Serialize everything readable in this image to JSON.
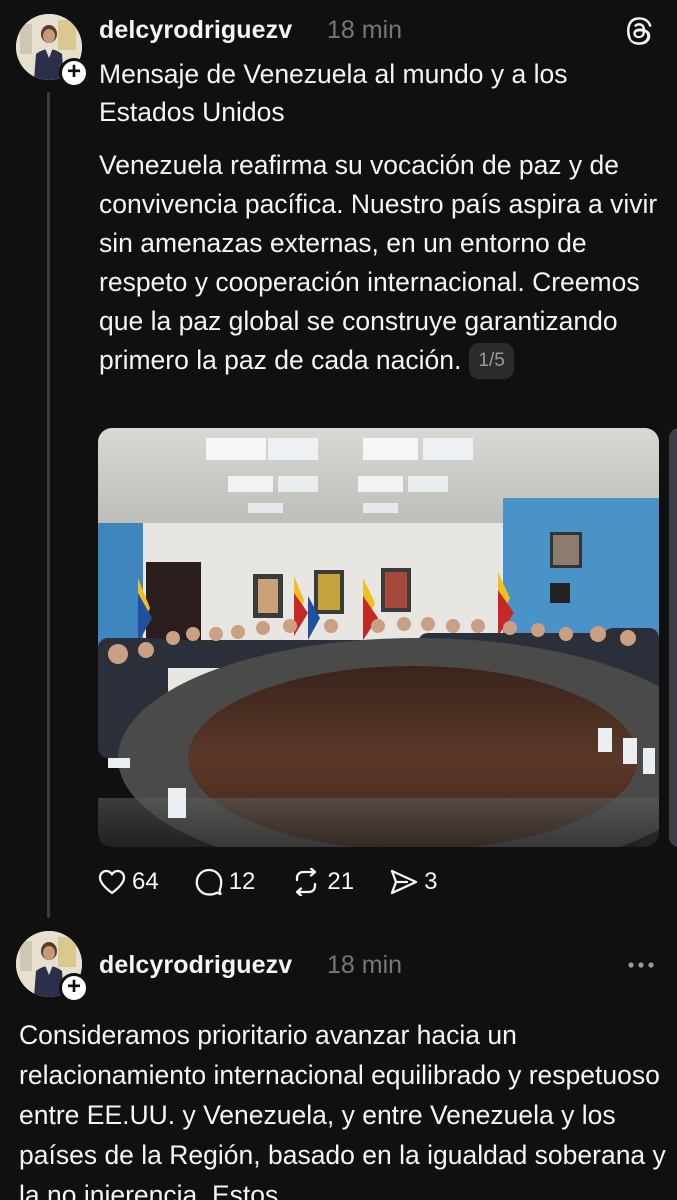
{
  "post1": {
    "username": "delcyrodriguezv",
    "time": "18 min",
    "title": "Mensaje de Venezuela al mundo y a los Estados Unidos",
    "body": "Venezuela reafirma su vocación de paz y de convivencia pacífica. Nuestro país aspira a vivir sin amenazas externas, en un entorno de respeto y cooperación internacional. Creemos que la paz global se construye garantizando primero la paz de cada nación.",
    "page_indicator": "1/5",
    "icon_top_right": "threads-logo-icon",
    "actions": {
      "likes": "64",
      "comments": "12",
      "reposts": "21",
      "shares": "3"
    }
  },
  "post2": {
    "username": "delcyrodriguezv",
    "time": "18 min",
    "body": "Consideramos prioritario avanzar hacia un relacionamiento internacional equilibrado y respetuoso entre EE.UU. y Venezuela, y entre Venezuela y los países de la Región, basado en la igualdad soberana y la no injerencia. Estos",
    "icon_top_right": "more-options-icon"
  },
  "colors": {
    "background": "#101010",
    "text": "#f3f5f7",
    "muted": "#777777",
    "thread_line": "#3a3a3a"
  }
}
